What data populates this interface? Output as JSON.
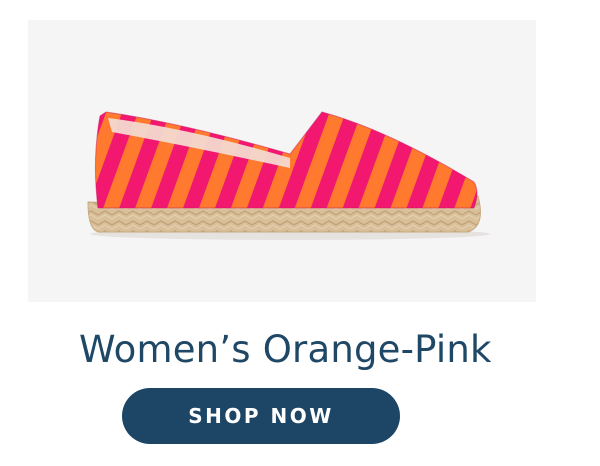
{
  "product": {
    "image": {
      "icon": "striped-espadrille-shoe",
      "colors": {
        "background": "#f6f5f5",
        "stripe_pink": "#f2186f",
        "stripe_orange": "#ff7a2e",
        "jute_sole": "#d9c09a",
        "lining": "#f3d9cf"
      }
    },
    "title": "Women’s Orange-Pink"
  },
  "cta": {
    "label": "SHOP NOW",
    "color": "#1c4566"
  }
}
